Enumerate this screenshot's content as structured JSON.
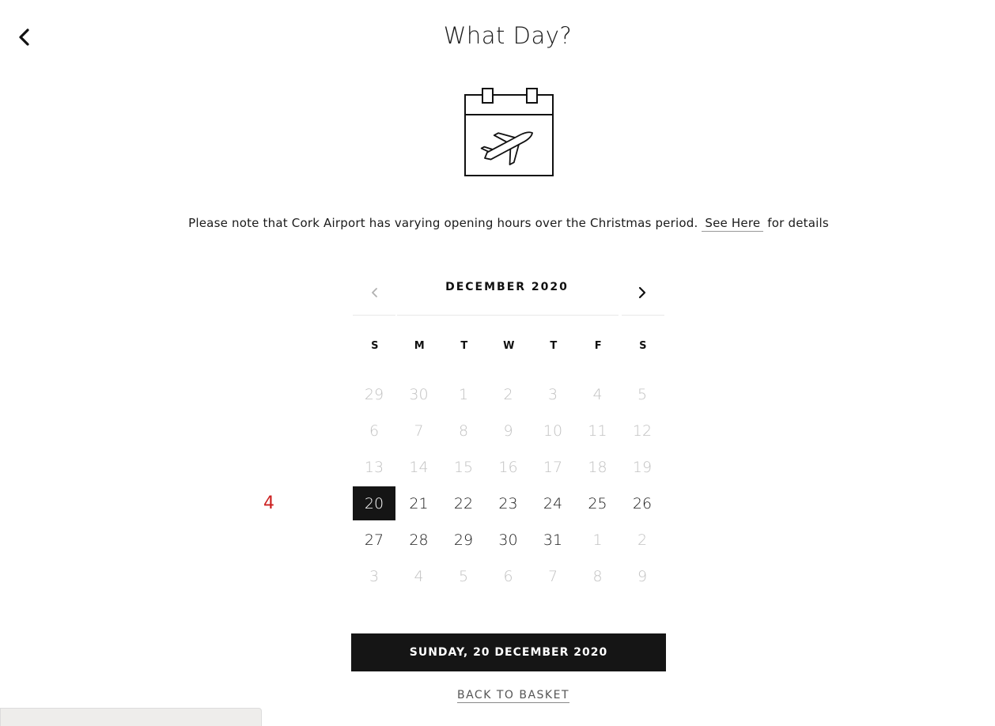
{
  "header": {
    "title": "What Day?",
    "back_icon": "chevron-left-icon"
  },
  "hero": {
    "icon": "calendar-airplane-icon"
  },
  "notice": {
    "text_before": "Please note that Cork Airport has varying opening hours over the Christmas period.",
    "link_text": "See Here",
    "text_after": "for details"
  },
  "calendar": {
    "month_label": "DECEMBER 2020",
    "prev_icon": "chevron-left-icon",
    "next_icon": "chevron-right-icon",
    "weekdays": [
      "S",
      "M",
      "T",
      "W",
      "T",
      "F",
      "S"
    ],
    "weeks": [
      [
        {
          "d": "29",
          "muted": true
        },
        {
          "d": "30",
          "muted": true
        },
        {
          "d": "1",
          "muted": true
        },
        {
          "d": "2",
          "muted": true
        },
        {
          "d": "3",
          "muted": true
        },
        {
          "d": "4",
          "muted": true
        },
        {
          "d": "5",
          "muted": true
        }
      ],
      [
        {
          "d": "6",
          "muted": true
        },
        {
          "d": "7",
          "muted": true
        },
        {
          "d": "8",
          "muted": true
        },
        {
          "d": "9",
          "muted": true
        },
        {
          "d": "10",
          "muted": true
        },
        {
          "d": "11",
          "muted": true
        },
        {
          "d": "12",
          "muted": true
        }
      ],
      [
        {
          "d": "13",
          "muted": true
        },
        {
          "d": "14",
          "muted": true
        },
        {
          "d": "15",
          "muted": true
        },
        {
          "d": "16",
          "muted": true
        },
        {
          "d": "17",
          "muted": true
        },
        {
          "d": "18",
          "muted": true
        },
        {
          "d": "19",
          "muted": true
        }
      ],
      [
        {
          "d": "20",
          "selected": true
        },
        {
          "d": "21"
        },
        {
          "d": "22"
        },
        {
          "d": "23"
        },
        {
          "d": "24"
        },
        {
          "d": "25"
        },
        {
          "d": "26"
        }
      ],
      [
        {
          "d": "27"
        },
        {
          "d": "28"
        },
        {
          "d": "29"
        },
        {
          "d": "30"
        },
        {
          "d": "31"
        },
        {
          "d": "1",
          "muted": true
        },
        {
          "d": "2",
          "muted": true
        }
      ],
      [
        {
          "d": "3",
          "muted": true
        },
        {
          "d": "4",
          "muted": true
        },
        {
          "d": "5",
          "muted": true
        },
        {
          "d": "6",
          "muted": true
        },
        {
          "d": "7",
          "muted": true
        },
        {
          "d": "8",
          "muted": true
        },
        {
          "d": "9",
          "muted": true
        }
      ]
    ]
  },
  "annotation": {
    "marker": "4"
  },
  "actions": {
    "confirm_label": "SUNDAY, 20 DECEMBER 2020",
    "back_to_basket_label": "BACK TO BASKET"
  },
  "colors": {
    "accent_dark": "#151515",
    "muted_day": "#c2c2c2",
    "marker": "#cc1f1f"
  }
}
